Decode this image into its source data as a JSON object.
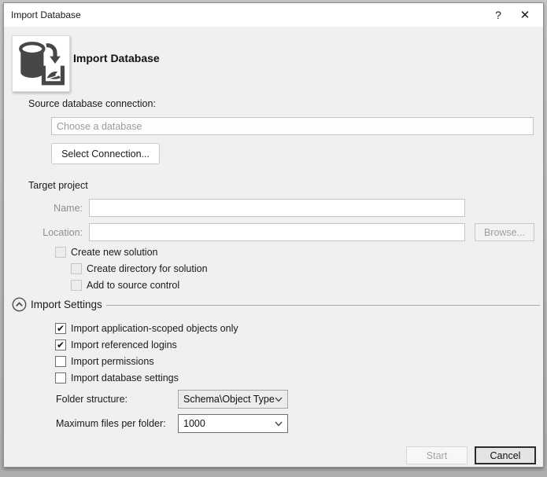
{
  "window": {
    "title": "Import Database",
    "help_glyph": "?",
    "close_glyph": "✕"
  },
  "header": {
    "title": "Import Database",
    "icon": "import-database-icon"
  },
  "source": {
    "label": "Source database connection:",
    "placeholder": "Choose a database",
    "value": "",
    "select_button": "Select Connection..."
  },
  "target": {
    "label": "Target project",
    "name_label": "Name:",
    "name_value": "",
    "location_label": "Location:",
    "location_value": "",
    "browse_button": "Browse...",
    "checkboxes": [
      {
        "label": "Create new solution",
        "glyph": "",
        "checked": false,
        "disabled": true
      },
      {
        "label": "Create directory for solution",
        "glyph": "",
        "checked": false,
        "disabled": true
      },
      {
        "label": "Add to source control",
        "glyph": "",
        "checked": false,
        "disabled": true
      }
    ]
  },
  "import_settings": {
    "label": "Import Settings",
    "expanded": true,
    "checkboxes": [
      {
        "label": "Import application-scoped objects only",
        "glyph": "✔",
        "checked": true
      },
      {
        "label": "Import referenced logins",
        "glyph": "✔",
        "checked": true
      },
      {
        "label": "Import permissions",
        "glyph": "",
        "checked": false
      },
      {
        "label": "Import database settings",
        "glyph": "",
        "checked": false
      }
    ],
    "folder_structure": {
      "label": "Folder structure:",
      "value": "Schema\\Object Type"
    },
    "max_files": {
      "label": "Maximum files per folder:",
      "value": "1000"
    }
  },
  "footer": {
    "start_button": "Start",
    "cancel_button": "Cancel"
  },
  "colors": {
    "titlebar_bg": "#ffffff",
    "body_bg": "#f0f0f0",
    "icon_ink": "#474747",
    "disabled_text": "#9f9f9f"
  }
}
